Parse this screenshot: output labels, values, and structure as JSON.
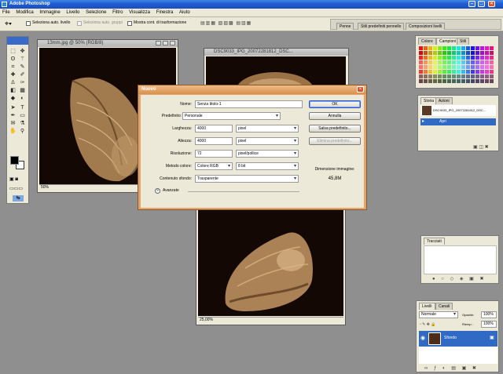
{
  "app": {
    "title": "Adobe Photoshop"
  },
  "menu": [
    "File",
    "Modifica",
    "Immagine",
    "Livello",
    "Selezione",
    "Filtro",
    "Visualizza",
    "Finestra",
    "Aiuto"
  ],
  "options": {
    "auto_select_layer": "Seleziona auto. livello",
    "auto_select_groups": "Seleziona auto. gruppi",
    "show_transform": "Mostra cont. di trasformazione",
    "tabs": [
      "Penne",
      "Stili predefiniti pennello",
      "Composizioni livelli"
    ]
  },
  "documents": [
    {
      "title": "13mm.jpg @ 50% (RGB/8)",
      "zoom": "50%"
    },
    {
      "title": "DSC9033_IPG_20072281812_DSC...",
      "zoom": ""
    },
    {
      "title": "",
      "zoom": "25,00%"
    }
  ],
  "dialog": {
    "title": "Nuovo",
    "name_label": "Nome:",
    "name_value": "Senza titolo-1",
    "preset_label": "Predefinito:",
    "preset_value": "Personale",
    "width_label": "Larghezza:",
    "width_value": "4000",
    "width_unit": "pixel",
    "height_label": "Altezza:",
    "height_value": "4000",
    "height_unit": "pixel",
    "resolution_label": "Risoluzione:",
    "resolution_value": "72",
    "resolution_unit": "pixel/pollice",
    "color_mode_label": "Metodo colore:",
    "color_mode_value": "Colore RGB",
    "bit_depth": "8 bit",
    "background_label": "Contenuto sfondo:",
    "background_value": "Trasparente",
    "advanced_label": "Avanzate",
    "ok": "OK",
    "cancel": "Annulla",
    "save_preset": "Salva predefinito...",
    "delete_preset": "Elimina predefinito...",
    "image_size_label": "Dimensione immagine:",
    "image_size_value": "45,8M"
  },
  "swatches_panel": {
    "tabs": [
      "Colore",
      "Campioni",
      "Stili"
    ]
  },
  "history_panel": {
    "tabs": [
      "Storia",
      "Azioni"
    ],
    "snapshot": "DSC9033_IPG_20072281812_DSC...",
    "step": "Apri"
  },
  "paths_panel": {
    "title": "Tracciati"
  },
  "layers_panel": {
    "tabs": [
      "Livelli",
      "Canali"
    ],
    "mode": "Normale",
    "opacity_label": "Opacità:",
    "opacity_value": "100%",
    "fill_label": "Riemp.:",
    "fill_value": "100%",
    "layer_name": "Sfondo"
  },
  "colors": {
    "titlebar": "#1f5bd0",
    "selection": "#316ac5",
    "dialog_frame": "#e3a36b",
    "canvas_bg": "#140805",
    "shell": "#b08a5e"
  }
}
